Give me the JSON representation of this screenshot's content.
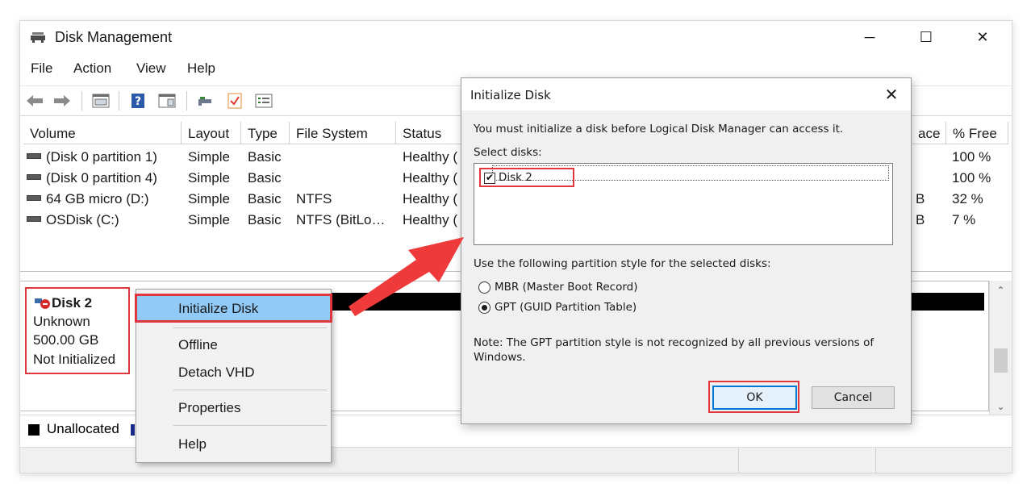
{
  "window": {
    "title": "Disk Management",
    "controls": {
      "minimize": "─",
      "maximize": "☐",
      "close": "✕"
    }
  },
  "menu": [
    "File",
    "Action",
    "View",
    "Help"
  ],
  "volume_table": {
    "headers": [
      "Volume",
      "Layout",
      "Type",
      "File System",
      "Status",
      "ace",
      "% Free"
    ],
    "rows": [
      {
        "volume": "(Disk 0 partition 1)",
        "layout": "Simple",
        "type": "Basic",
        "fs": "",
        "status": "Healthy (",
        "space": "",
        "free": "100 %"
      },
      {
        "volume": "(Disk 0 partition 4)",
        "layout": "Simple",
        "type": "Basic",
        "fs": "",
        "status": "Healthy (",
        "space": "",
        "free": "100 %"
      },
      {
        "volume": "64 GB micro (D:)",
        "layout": "Simple",
        "type": "Basic",
        "fs": "NTFS",
        "status": "Healthy (",
        "space": "B",
        "free": "32 %"
      },
      {
        "volume": "OSDisk (C:)",
        "layout": "Simple",
        "type": "Basic",
        "fs": "NTFS (BitLo…",
        "status": "Healthy (",
        "space": "B",
        "free": "7 %"
      }
    ]
  },
  "disk": {
    "name": "Disk 2",
    "kind": "Unknown",
    "size": "500.00 GB",
    "state": "Not Initialized"
  },
  "legend": {
    "unallocated": "Unallocated"
  },
  "context_menu": {
    "initialize": "Initialize Disk",
    "offline": "Offline",
    "detach": "Detach VHD",
    "properties": "Properties",
    "help": "Help"
  },
  "dialog": {
    "title": "Initialize Disk",
    "intro": "You must initialize a disk before Logical Disk Manager can access it.",
    "select_label": "Select disks:",
    "disk_item": "Disk 2",
    "style_label": "Use the following partition style for the selected disks:",
    "mbr": "MBR (Master Boot Record)",
    "gpt": "GPT (GUID Partition Table)",
    "note_line1": "Note: The GPT partition style is not recognized by all previous versions of",
    "note_line2": "Windows.",
    "ok": "OK",
    "cancel": "Cancel"
  },
  "colors": {
    "highlight_red": "#e0363e",
    "menu_highlight": "#91c9f7",
    "arrow": "#ee3a3a"
  }
}
